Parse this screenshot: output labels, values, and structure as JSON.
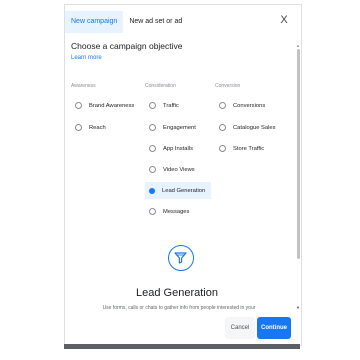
{
  "tabs": [
    "New campaign",
    "New ad set or ad"
  ],
  "close_label": "X",
  "title": "Choose a campaign objective",
  "learn_more": "Learn more",
  "columns": [
    {
      "heading": "Awareness",
      "options": [
        "Brand Awareness",
        "Reach"
      ]
    },
    {
      "heading": "Consideration",
      "options": [
        "Traffic",
        "Engagement",
        "App Installs",
        "Video Views",
        "Lead Generation",
        "Messages"
      ]
    },
    {
      "heading": "Conversion",
      "options": [
        "Conversions",
        "Catalogue Sales",
        "Store Traffic"
      ]
    }
  ],
  "selected_option": "Lead Generation",
  "detail": {
    "icon": "filter-funnel-icon",
    "title": "Lead Generation",
    "description": "Use forms, calls or chats to gather info from people interested in your"
  },
  "buttons": {
    "cancel": "Cancel",
    "continue": "Continue"
  },
  "scrollbar": {
    "up": "▲",
    "down": "▼"
  },
  "colors": {
    "accent": "#1877f2",
    "selected_bg": "#e7f3ff"
  }
}
